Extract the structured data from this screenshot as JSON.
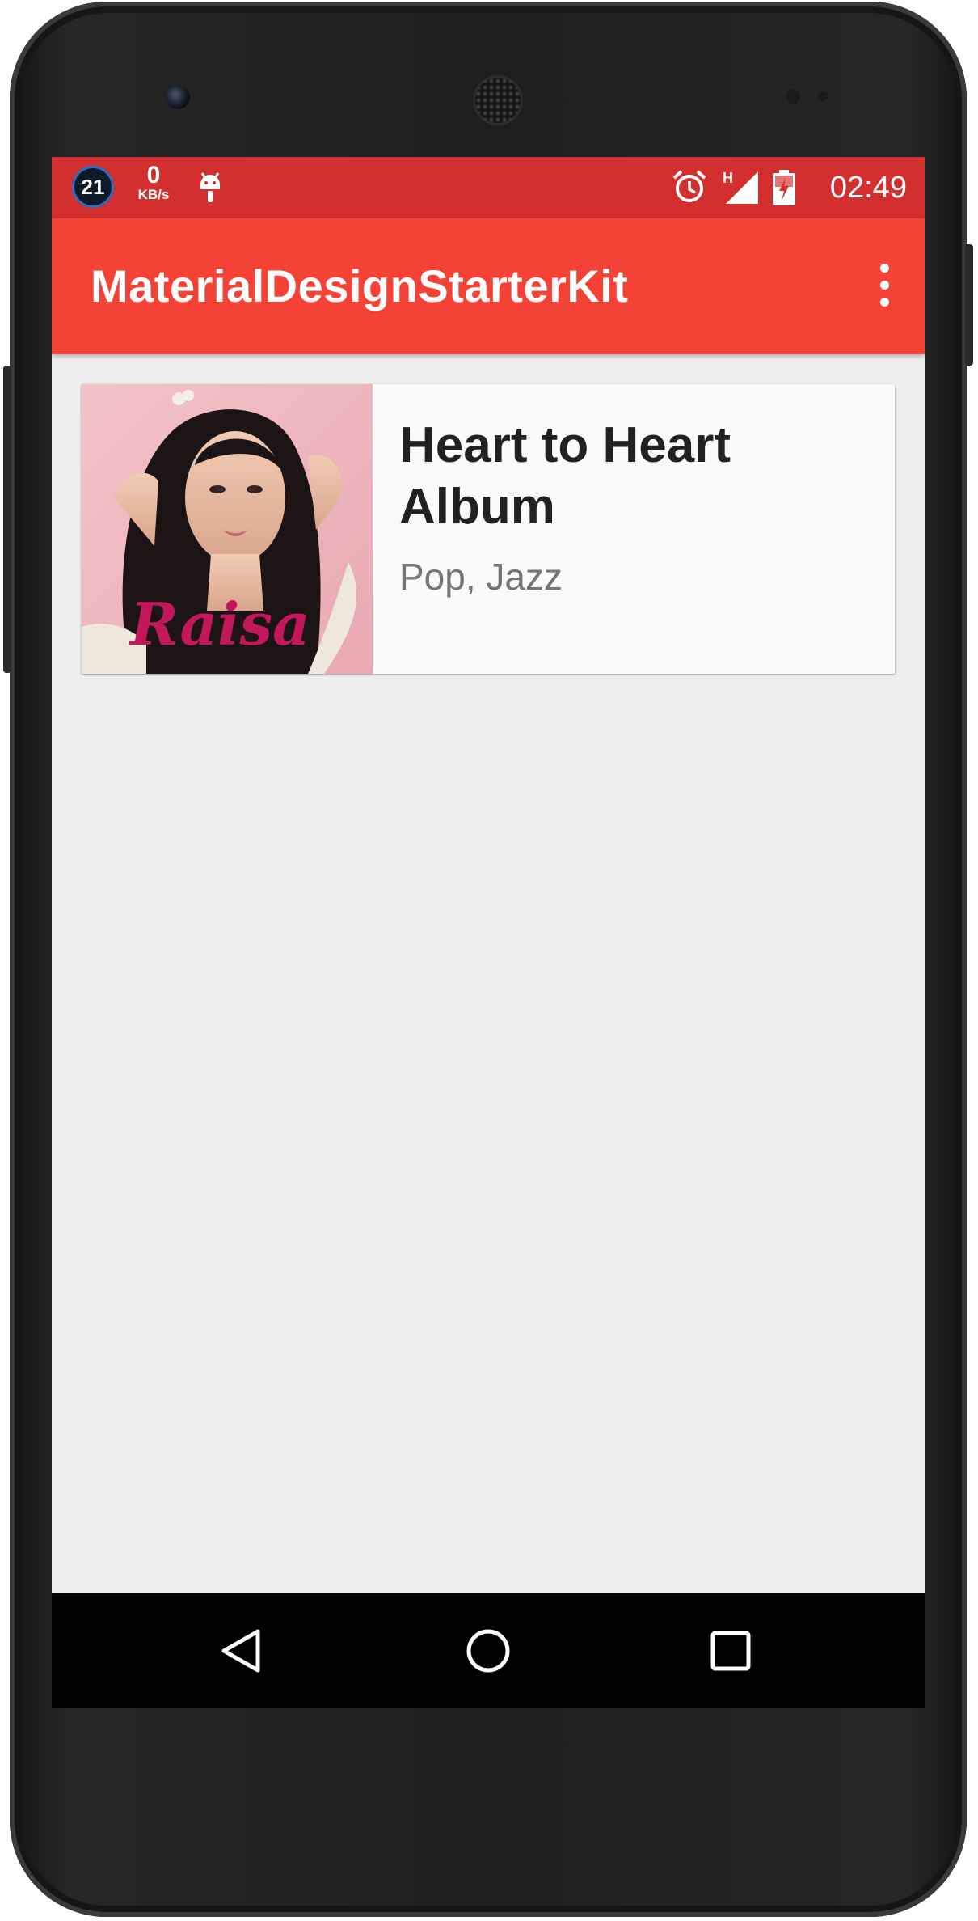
{
  "status_bar": {
    "badge_number": "21",
    "net_speed_value": "0",
    "net_speed_unit": "KB/s",
    "network_label": "H",
    "time": "02:49",
    "icons": [
      "android-debug-icon",
      "alarm-icon",
      "signal-icon",
      "battery-charging-icon"
    ]
  },
  "app_bar": {
    "title": "MaterialDesignStarterKit",
    "overflow_icon": "more-vert-icon"
  },
  "cards": [
    {
      "title": "Heart to Heart Album",
      "subtitle": "Pop, Jazz",
      "album_art_text": "Raisa"
    }
  ],
  "fab": {
    "label": "+"
  },
  "nav_bar": {
    "icons": [
      "back-icon",
      "home-icon",
      "recents-icon"
    ]
  },
  "colors": {
    "status_bar": "#d32f2f",
    "app_bar": "#f44336",
    "fab": "#607d8b",
    "background": "#eeeeee"
  }
}
